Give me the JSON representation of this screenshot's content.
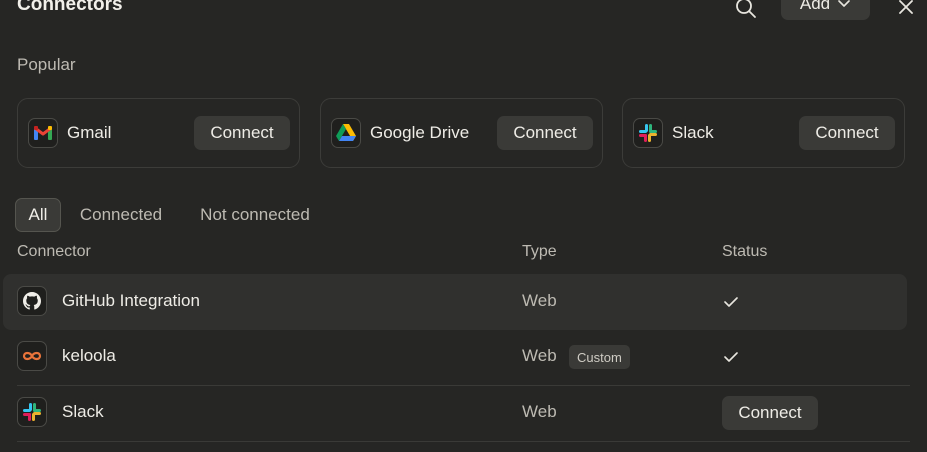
{
  "header": {
    "title": "Connectors",
    "add_label": "Add"
  },
  "popular": {
    "label": "Popular",
    "cards": [
      {
        "name": "Gmail",
        "icon": "gmail-icon",
        "connect_label": "Connect"
      },
      {
        "name": "Google Drive",
        "icon": "google-drive-icon",
        "connect_label": "Connect"
      },
      {
        "name": "Slack",
        "icon": "slack-icon",
        "connect_label": "Connect"
      }
    ]
  },
  "filters": {
    "all": "All",
    "connected": "Connected",
    "not_connected": "Not connected",
    "active": "All"
  },
  "table": {
    "columns": {
      "connector": "Connector",
      "type": "Type",
      "status": "Status"
    },
    "rows": [
      {
        "name": "GitHub Integration",
        "icon": "github-icon",
        "type": "Web",
        "badge": "",
        "status": "connected"
      },
      {
        "name": "keloola",
        "icon": "infinity-icon",
        "type": "Web",
        "badge": "Custom",
        "status": "connected"
      },
      {
        "name": "Slack",
        "icon": "slack-icon",
        "type": "Web",
        "badge": "",
        "status": "not-connected",
        "connect_label": "Connect"
      }
    ]
  },
  "colors": {
    "background": "#262624",
    "surface": "#3a3a37",
    "row_hover": "#30302e",
    "text_primary": "#eeece6",
    "text_secondary": "#bdbab2",
    "keloola_orange": "#e8743b"
  }
}
